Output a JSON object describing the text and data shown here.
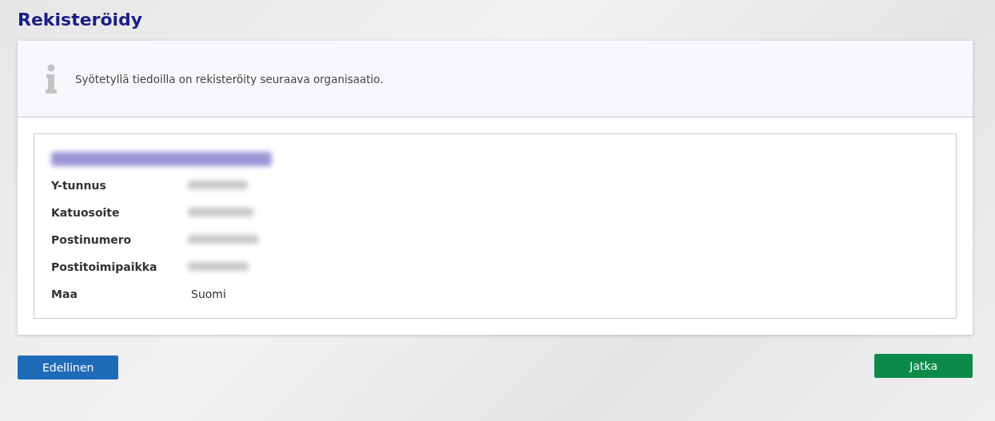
{
  "title": "Rekisteröidy",
  "notice": {
    "text": "Syötetyllä tiedoilla on rekisteröity seuraava organisaatio."
  },
  "organization": {
    "name_redacted": true,
    "fields": [
      {
        "label": "Y-tunnus",
        "redacted": true
      },
      {
        "label": "Katuosoite",
        "redacted": true
      },
      {
        "label": "Postinumero",
        "redacted": true
      },
      {
        "label": "Postitoimipaikka",
        "redacted": true
      },
      {
        "label": "Maa",
        "redacted": false,
        "value": "Suomi"
      }
    ]
  },
  "buttons": [
    {
      "label": "Edellinen",
      "kind": "back"
    },
    {
      "label": "Jatka",
      "kind": "next"
    }
  ]
}
